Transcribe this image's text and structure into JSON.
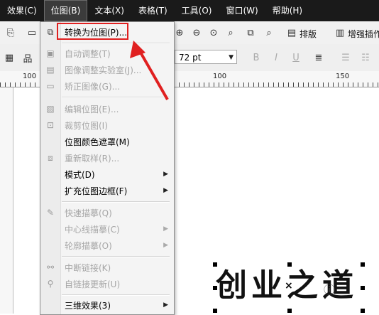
{
  "menubar": {
    "items": [
      "效果(C)",
      "位图(B)",
      "文本(X)",
      "表格(T)",
      "工具(O)",
      "窗口(W)",
      "帮助(H)"
    ]
  },
  "toolbar": {
    "layout_label": "排版",
    "enhance_label": "增强插作"
  },
  "font_size": {
    "value": "72 pt"
  },
  "ruler": {
    "labels": [
      "100",
      "50",
      "100",
      "150"
    ]
  },
  "bitmap_menu": {
    "items": [
      {
        "label": "转换为位图(P)...",
        "disabled": false,
        "submenu": false,
        "icon": "convert-bitmap-icon"
      },
      {
        "label": "自动调整(T)",
        "disabled": true,
        "submenu": false,
        "icon": "auto-adjust-icon"
      },
      {
        "label": "图像调整实验室(J)...",
        "disabled": true,
        "submenu": false,
        "icon": "image-lab-icon"
      },
      {
        "label": "矫正图像(G)...",
        "disabled": true,
        "submenu": false,
        "icon": "straighten-icon"
      },
      {
        "label": "编辑位图(E)...",
        "disabled": true,
        "submenu": false,
        "icon": "edit-bitmap-icon"
      },
      {
        "label": "裁剪位图(I)",
        "disabled": true,
        "submenu": false,
        "icon": "crop-bitmap-icon"
      },
      {
        "label": "位图颜色遮罩(M)",
        "disabled": false,
        "submenu": false,
        "icon": ""
      },
      {
        "label": "重新取样(R)...",
        "disabled": true,
        "submenu": false,
        "icon": "resample-icon"
      },
      {
        "label": "模式(D)",
        "disabled": false,
        "submenu": true,
        "icon": ""
      },
      {
        "label": "扩充位图边框(F)",
        "disabled": false,
        "submenu": true,
        "icon": ""
      },
      {
        "label": "快速描摹(Q)",
        "disabled": true,
        "submenu": false,
        "icon": "quick-trace-icon"
      },
      {
        "label": "中心线描摹(C)",
        "disabled": true,
        "submenu": true,
        "icon": ""
      },
      {
        "label": "轮廓描摹(O)",
        "disabled": true,
        "submenu": true,
        "icon": ""
      },
      {
        "label": "中断链接(K)",
        "disabled": true,
        "submenu": false,
        "icon": "break-link-icon"
      },
      {
        "label": "自链接更新(U)",
        "disabled": true,
        "submenu": false,
        "icon": "update-link-icon"
      },
      {
        "label": "三维效果(3)",
        "disabled": false,
        "submenu": true,
        "icon": ""
      }
    ]
  },
  "canvas_text": {
    "value": "创业之道"
  },
  "watermark": {
    "value": "ⓘ"
  },
  "colors": {
    "highlight": "#e02020",
    "arrow": "#e02020",
    "menubar": "#1a1a1a"
  }
}
